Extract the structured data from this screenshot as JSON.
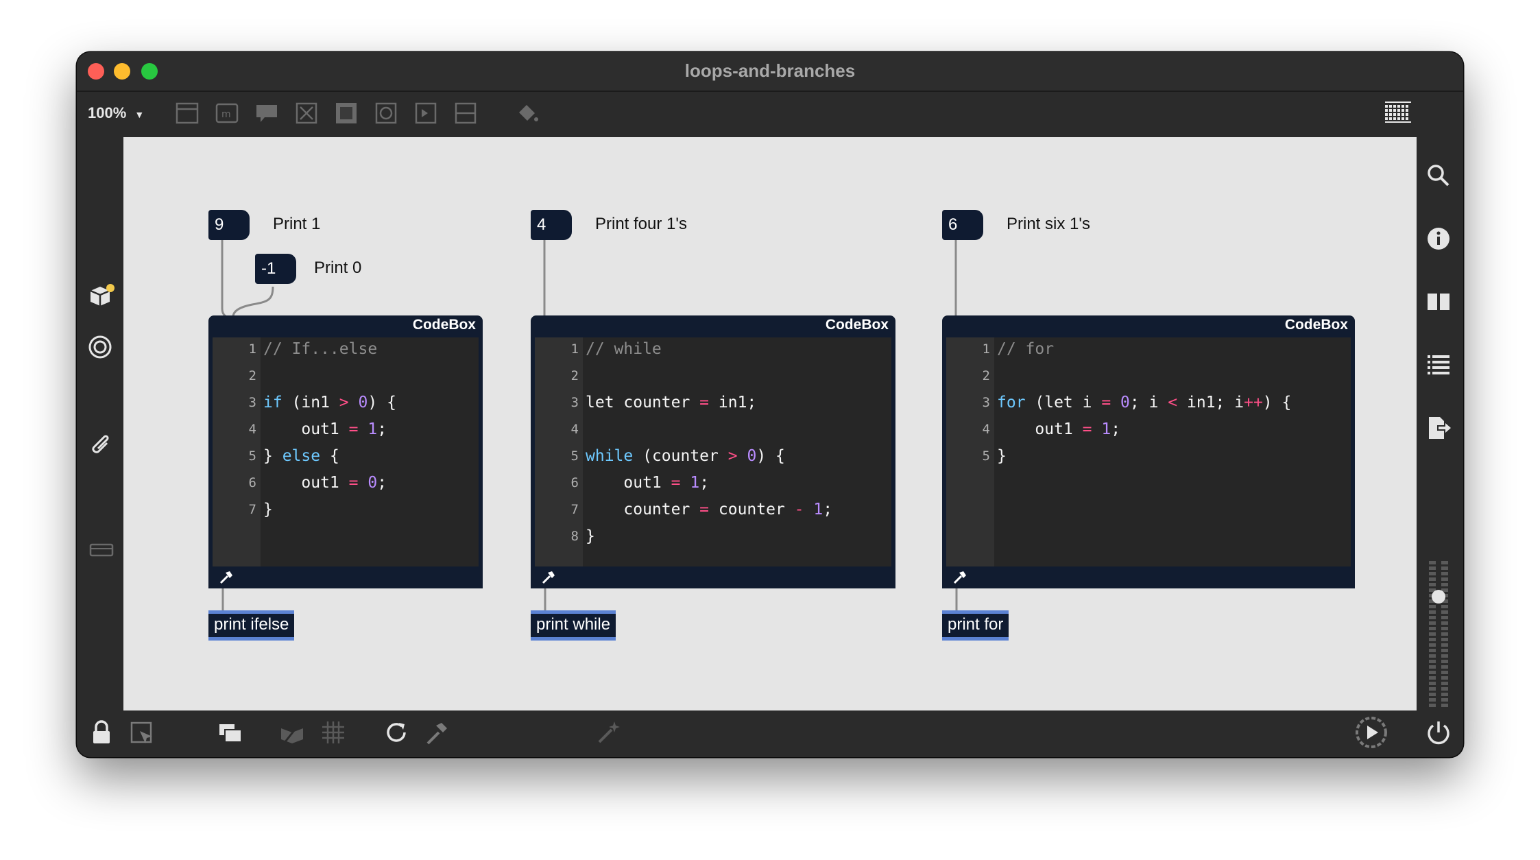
{
  "window": {
    "title": "loops-and-branches"
  },
  "toolbar": {
    "zoom": "100%",
    "icons": [
      "new-object-icon",
      "message-icon",
      "comment-icon",
      "toggle-icon",
      "matrix-icon",
      "bang-icon",
      "slider-icon",
      "divider-icon",
      "paint-bucket-icon",
      "grid-keyboard-icon"
    ]
  },
  "left_sidebar": [
    "packages-icon",
    "target-icon",
    "paperclip-icon",
    "presentation-icon"
  ],
  "right_sidebar": [
    "search-icon",
    "info-icon",
    "columns-icon",
    "list-icon",
    "export-icon",
    "level-meter"
  ],
  "bottom_bar": [
    "lock-icon",
    "edit-cursor-icon",
    "stack-icon",
    "hide-icon",
    "grid-icon",
    "refresh-icon",
    "hammer-icon",
    "wand-icon",
    "play-icon",
    "power-icon"
  ],
  "patch": {
    "group1": {
      "num_a": "9",
      "comment_a": "Print 1",
      "num_b": "-1",
      "comment_b": "Print 0",
      "codebox_title": "CodeBox",
      "print_label": "print ifelse",
      "code": [
        {
          "n": "1",
          "segs": [
            {
              "t": "// If...else",
              "c": "comment"
            }
          ]
        },
        {
          "n": "2",
          "segs": []
        },
        {
          "n": "3",
          "segs": [
            {
              "t": "if",
              "c": "kw"
            },
            {
              "t": " (in1 ",
              "c": ""
            },
            {
              "t": ">",
              "c": "op"
            },
            {
              "t": " ",
              "c": ""
            },
            {
              "t": "0",
              "c": "num"
            },
            {
              "t": ") {",
              "c": ""
            }
          ]
        },
        {
          "n": "4",
          "segs": [
            {
              "t": "    out1 ",
              "c": ""
            },
            {
              "t": "=",
              "c": "op"
            },
            {
              "t": " ",
              "c": ""
            },
            {
              "t": "1",
              "c": "num"
            },
            {
              "t": ";",
              "c": ""
            }
          ]
        },
        {
          "n": "5",
          "segs": [
            {
              "t": "} ",
              "c": ""
            },
            {
              "t": "else",
              "c": "kw"
            },
            {
              "t": " {",
              "c": ""
            }
          ]
        },
        {
          "n": "6",
          "segs": [
            {
              "t": "    out1 ",
              "c": ""
            },
            {
              "t": "=",
              "c": "op"
            },
            {
              "t": " ",
              "c": ""
            },
            {
              "t": "0",
              "c": "num"
            },
            {
              "t": ";",
              "c": ""
            }
          ]
        },
        {
          "n": "7",
          "segs": [
            {
              "t": "}",
              "c": ""
            }
          ]
        }
      ]
    },
    "group2": {
      "num_a": "4",
      "comment_a": "Print four 1's",
      "codebox_title": "CodeBox",
      "print_label": "print while",
      "code": [
        {
          "n": "1",
          "segs": [
            {
              "t": "// while",
              "c": "comment"
            }
          ]
        },
        {
          "n": "2",
          "segs": []
        },
        {
          "n": "3",
          "segs": [
            {
              "t": "let counter ",
              "c": ""
            },
            {
              "t": "=",
              "c": "op"
            },
            {
              "t": " in1;",
              "c": ""
            }
          ]
        },
        {
          "n": "4",
          "segs": []
        },
        {
          "n": "5",
          "segs": [
            {
              "t": "while",
              "c": "kw"
            },
            {
              "t": " (counter ",
              "c": ""
            },
            {
              "t": ">",
              "c": "op"
            },
            {
              "t": " ",
              "c": ""
            },
            {
              "t": "0",
              "c": "num"
            },
            {
              "t": ") {",
              "c": ""
            }
          ]
        },
        {
          "n": "6",
          "segs": [
            {
              "t": "    out1 ",
              "c": ""
            },
            {
              "t": "=",
              "c": "op"
            },
            {
              "t": " ",
              "c": ""
            },
            {
              "t": "1",
              "c": "num"
            },
            {
              "t": ";",
              "c": ""
            }
          ]
        },
        {
          "n": "7",
          "segs": [
            {
              "t": "    counter ",
              "c": ""
            },
            {
              "t": "=",
              "c": "op"
            },
            {
              "t": " counter ",
              "c": ""
            },
            {
              "t": "-",
              "c": "op"
            },
            {
              "t": " ",
              "c": ""
            },
            {
              "t": "1",
              "c": "num"
            },
            {
              "t": ";",
              "c": ""
            }
          ]
        },
        {
          "n": "8",
          "segs": [
            {
              "t": "}",
              "c": ""
            }
          ]
        }
      ]
    },
    "group3": {
      "num_a": "6",
      "comment_a": "Print six 1's",
      "codebox_title": "CodeBox",
      "print_label": "print for",
      "code": [
        {
          "n": "1",
          "segs": [
            {
              "t": "// for",
              "c": "comment"
            }
          ]
        },
        {
          "n": "2",
          "segs": []
        },
        {
          "n": "3",
          "segs": [
            {
              "t": "for",
              "c": "kw"
            },
            {
              "t": " (let i ",
              "c": ""
            },
            {
              "t": "=",
              "c": "op"
            },
            {
              "t": " ",
              "c": ""
            },
            {
              "t": "0",
              "c": "num"
            },
            {
              "t": "; i ",
              "c": ""
            },
            {
              "t": "<",
              "c": "op"
            },
            {
              "t": " in1; i",
              "c": ""
            },
            {
              "t": "++",
              "c": "op"
            },
            {
              "t": ") {",
              "c": ""
            }
          ]
        },
        {
          "n": "4",
          "segs": [
            {
              "t": "    out1 ",
              "c": ""
            },
            {
              "t": "=",
              "c": "op"
            },
            {
              "t": " ",
              "c": ""
            },
            {
              "t": "1",
              "c": "num"
            },
            {
              "t": ";",
              "c": ""
            }
          ]
        },
        {
          "n": "5",
          "segs": [
            {
              "t": "}",
              "c": ""
            }
          ]
        }
      ]
    }
  }
}
